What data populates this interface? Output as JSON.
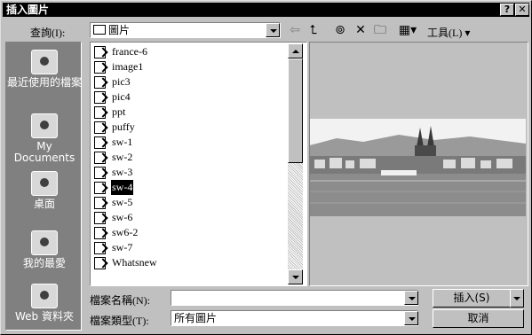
{
  "window": {
    "title": "插入圖片",
    "help_btn": "?",
    "close_btn": "✕"
  },
  "toolbar": {
    "look_in_label": "查詢(I):",
    "look_in_value": "圖片",
    "tools_label": "工具(L)"
  },
  "places": [
    {
      "label": "最近使用的檔案"
    },
    {
      "label": "My Documents"
    },
    {
      "label": "桌面"
    },
    {
      "label": "我的最愛"
    },
    {
      "label": "Web 資料夾"
    }
  ],
  "files": [
    "france-6",
    "image1",
    "pic3",
    "pic4",
    "ppt",
    "puffy",
    "sw-1",
    "sw-2",
    "sw-3",
    "sw-4",
    "sw-5",
    "sw-6",
    "sw6-2",
    "sw-7",
    "Whatsnew"
  ],
  "selected_file": "sw-4",
  "bottom": {
    "filename_label": "檔案名稱(N):",
    "filename_value": "",
    "filetype_label": "檔案類型(T):",
    "filetype_value": "所有圖片",
    "insert_label": "插入(S)",
    "cancel_label": "取消"
  }
}
